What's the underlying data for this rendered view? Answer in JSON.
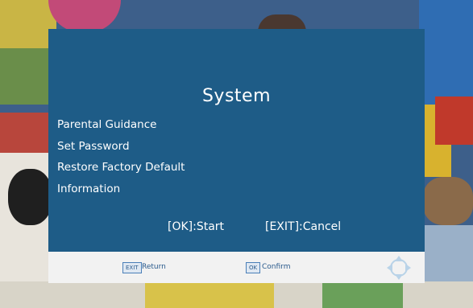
{
  "dialog": {
    "title": "System",
    "menu_items": [
      {
        "label": "Parental Guidance"
      },
      {
        "label": "Set Password"
      },
      {
        "label": "Restore Factory Default"
      },
      {
        "label": "Information"
      }
    ],
    "hint_ok": "[OK]:Start",
    "hint_exit": "[EXIT]:Cancel"
  },
  "footer": {
    "exit_key": "EXIT",
    "return_label": "Return",
    "ok_key": "OK",
    "confirm_label": "Confirm",
    "nav_icon": "navigation-arrows-icon"
  },
  "colors": {
    "dialog_background": "#1e5c87",
    "footer_background": "#f2f2f2",
    "text": "#ffffff",
    "footer_text": "#2a5a8c"
  }
}
